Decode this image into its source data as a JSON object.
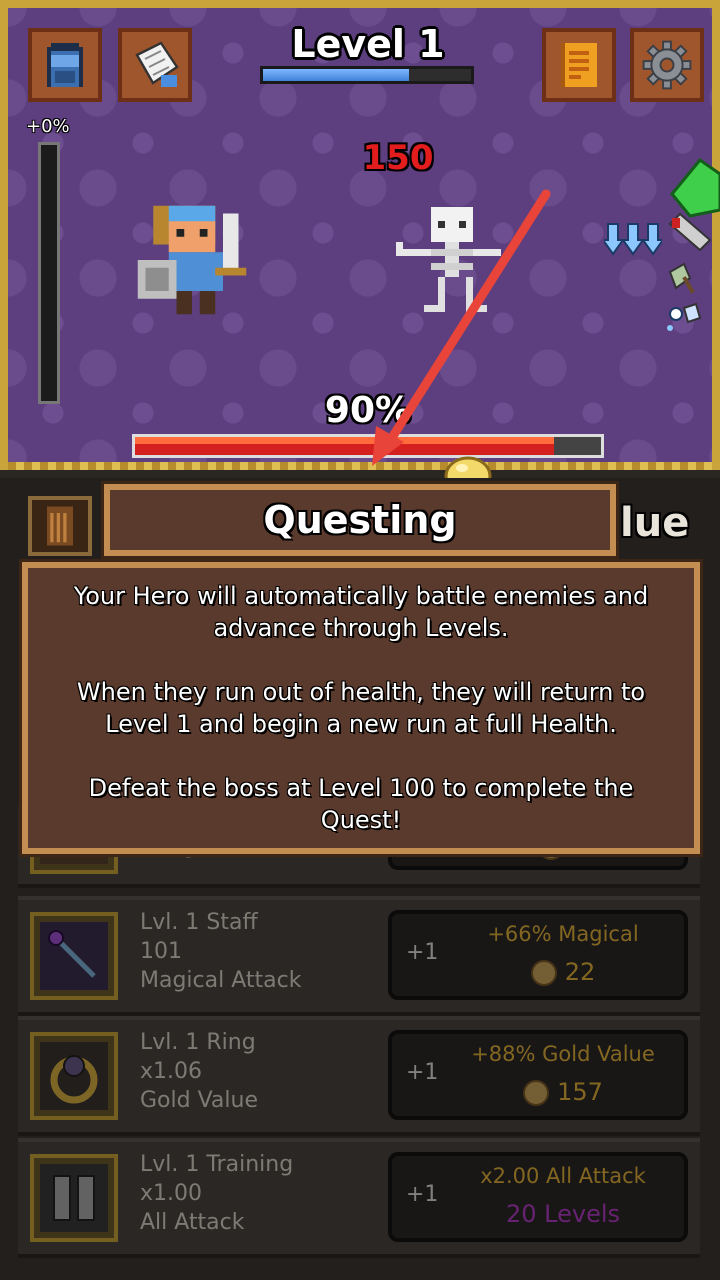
{
  "header": {
    "level_label": "Level 1",
    "level_progress": 0.7,
    "bonus_label": "+0%"
  },
  "battle": {
    "damage_text": "150",
    "hero_health_label": "90%",
    "hero_health": 0.9
  },
  "buttons": {
    "inventory": "backpack-icon",
    "map": "scroll-icon",
    "journal": "book-icon",
    "settings": "gear-icon"
  },
  "tooltip": {
    "title": "Questing",
    "paragraphs": [
      "Your Hero will automatically battle enemies and advance through Levels.",
      "When they run out of health, they will return to Level 1 and begin a new run at full Health.",
      "Defeat the boss at Level 100 to complete the Quest!"
    ],
    "behind_text": "lue"
  },
  "upgrades": [
    {
      "line1": "",
      "line2": "",
      "line3": "Ranged Attack",
      "plus": "",
      "bonus": "",
      "cost": "9"
    },
    {
      "line1": "Lvl. 1 Staff",
      "line2": "101",
      "line3": "Magical Attack",
      "plus": "+1",
      "bonus": "+66% Magical",
      "cost": "22"
    },
    {
      "line1": "Lvl. 1 Ring",
      "line2": "x1.06",
      "line3": "Gold Value",
      "plus": "+1",
      "bonus": "+88% Gold Value",
      "cost": "157"
    },
    {
      "line1": "Lvl. 1 Training",
      "line2": "x1.00",
      "line3": "All Attack",
      "plus": "+1",
      "bonus": "x2.00 All Attack",
      "cost": "20 Levels"
    }
  ],
  "colors": {
    "battle_bg": "#5d3f7f",
    "frame_gold": "#c8a43a",
    "tooltip_bg": "#5a3a2c",
    "tooltip_border": "#c48e52",
    "bonus_text": "#e2b23a",
    "levels_text": "#b43cc4",
    "damage_red": "#e31d1d",
    "arrow_red": "#e8443a"
  }
}
